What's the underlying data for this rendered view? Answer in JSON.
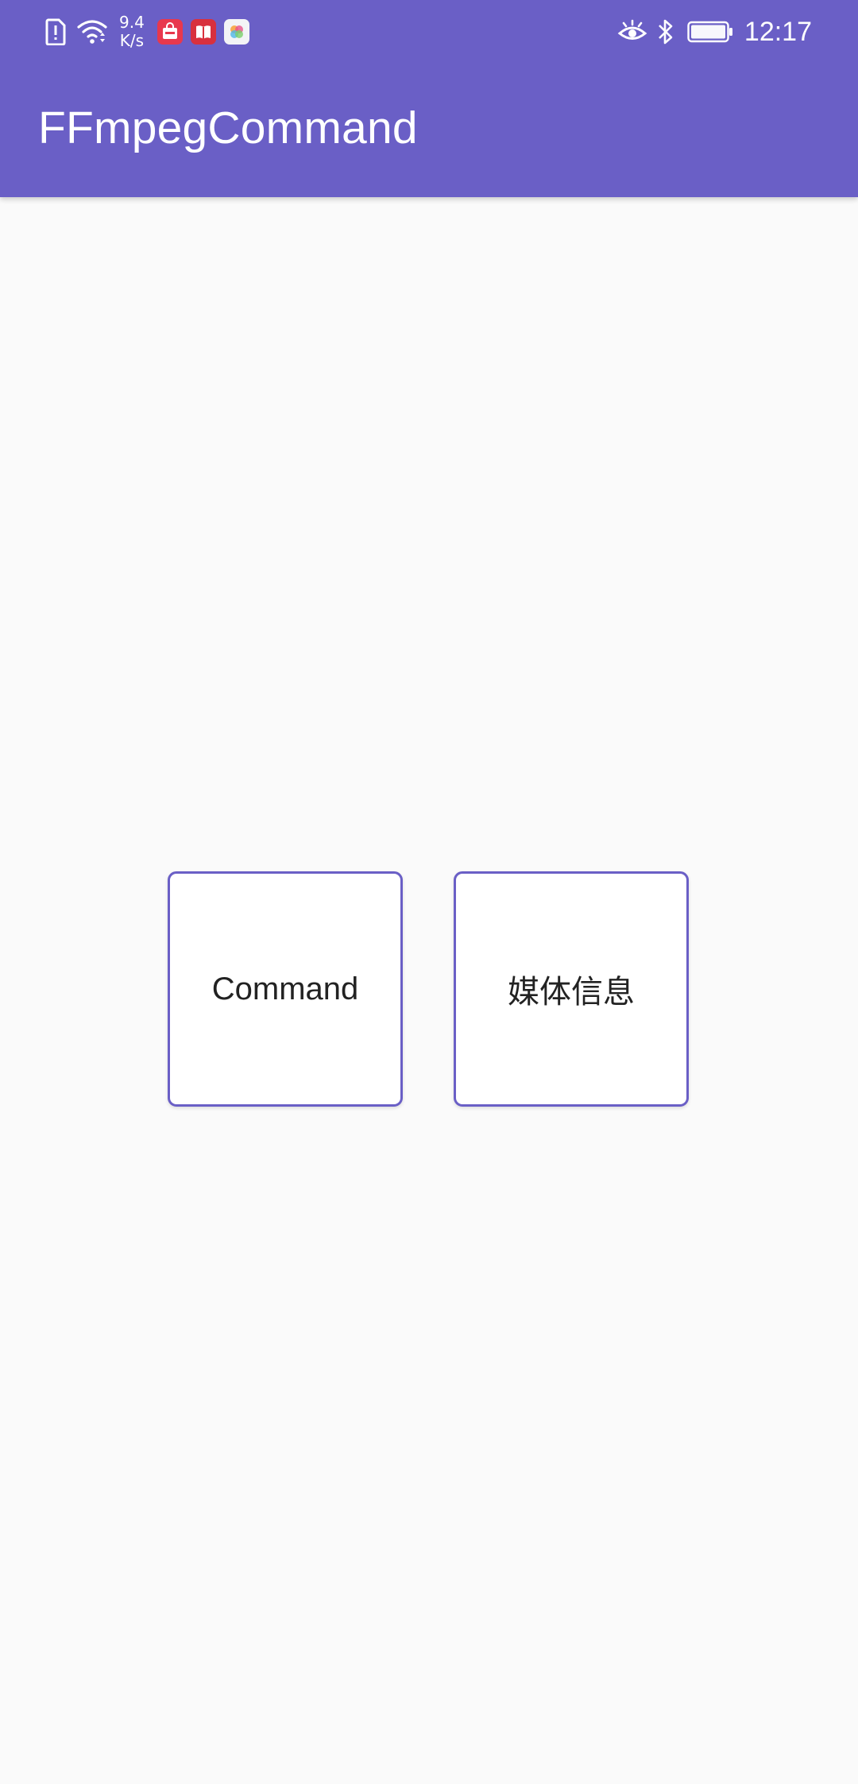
{
  "status_bar": {
    "net_speed_value": "9.4",
    "net_speed_unit": "K/s",
    "time": "12:17",
    "left_icons": [
      "sim-alert-icon",
      "wifi-icon"
    ],
    "notification_icons": [
      "shopping-bag-app-icon",
      "book-app-icon",
      "photos-app-icon"
    ],
    "right_icons": [
      "eye-comfort-icon",
      "bluetooth-icon",
      "battery-icon"
    ]
  },
  "app_bar": {
    "title": "FFmpegCommand",
    "color": "#6a5fc6"
  },
  "main": {
    "buttons": [
      {
        "label": "Command"
      },
      {
        "label": "媒体信息"
      }
    ]
  },
  "colors": {
    "primary": "#6a5fc6",
    "background": "#fafafa",
    "tile_background": "#ffffff"
  }
}
